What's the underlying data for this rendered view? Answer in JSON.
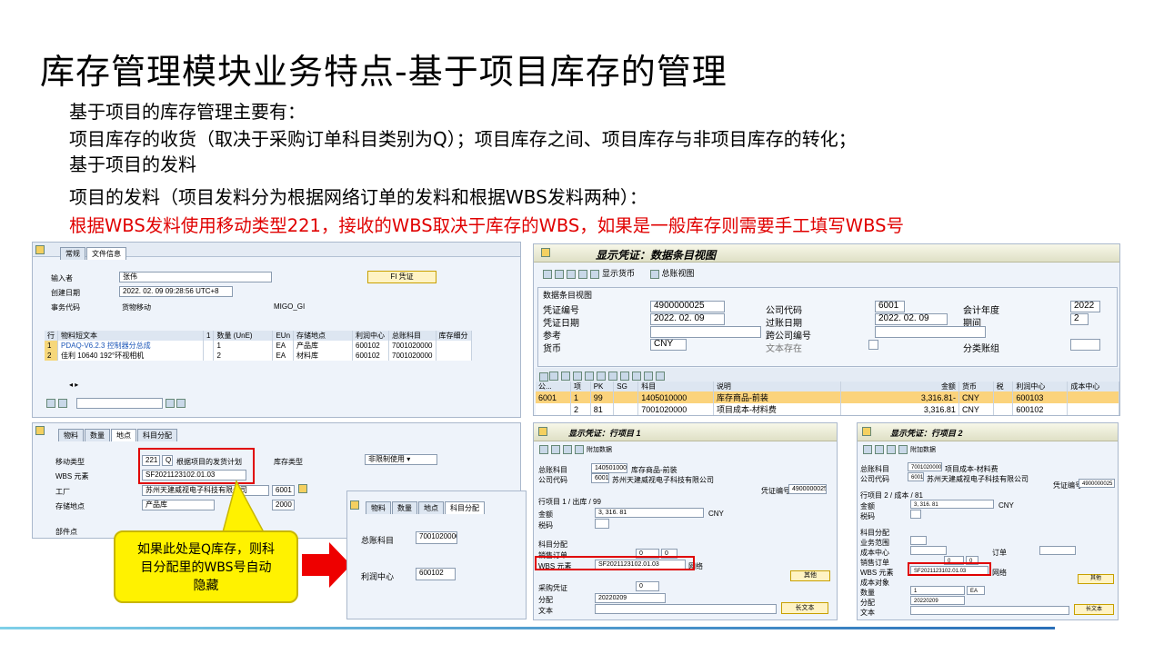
{
  "title": "库存管理模块业务特点-基于项目库存的管理",
  "bullets": [
    "基于项目的库存管理主要有：",
    "项目库存的收货（取决于采购订单科目类别为Q）；项目库存之间、项目库存与非项目库存的转化；",
    "基于项目的发料",
    "项目的发料（项目发料分为根据网络订单的发料和根据WBS发料两种）：",
    "根据WBS发料使用移动类型221，接收的WBS取决于库存的WBS，如果是一般库存则需要手工填写WBS号"
  ],
  "callout": {
    "lines": [
      "如果此处是Q库存，则科",
      "目分配里的WBS号自动",
      "隐藏"
    ]
  },
  "migo": {
    "tabs": [
      "常规",
      "文件信息"
    ],
    "rows": [
      {
        "label": "输入者",
        "value": "张伟"
      },
      {
        "label": "创建日期",
        "value": "2022. 02. 09 09:28:56 UTC+8"
      },
      {
        "label": "事务代码",
        "value": "货物移动",
        "extra": "MIGO_GI"
      }
    ],
    "fi_button": "FI 凭证",
    "table_headers": [
      "行",
      "物料短文本",
      "1",
      "数量 (UnE)",
      "EUn",
      "存储地点",
      "利润中心",
      "总账科目",
      "库存细分"
    ],
    "table_rows": [
      {
        "line": "1",
        "text": "PDAQ-V6.2.3 控制器分总成",
        "qty": "1",
        "eun": "EA",
        "sloc": "产品库",
        "pc": "600102",
        "gl": "7001020000"
      },
      {
        "line": "2",
        "text": "佳利 10640 192°环视相机",
        "qty": "2",
        "eun": "EA",
        "sloc": "材料库",
        "pc": "600102",
        "gl": "7001020000"
      }
    ],
    "detail_tabs": [
      "物料",
      "数量",
      "地点",
      "科目分配"
    ],
    "detail": {
      "move_type_label": "移动类型",
      "move_type": "221",
      "q": "Q",
      "move_desc": "根据项目的发货计划",
      "stock_type_label": "库存类型",
      "stock_type": "非限制使用",
      "wbs_label": "WBS 元素",
      "wbs": "SF2021123102.01.03",
      "plant_label": "工厂",
      "plant": "苏州天建威视电子科技有限公司",
      "plant_code": "6001",
      "sloc_label": "存储地点",
      "sloc": "产品库",
      "sloc_code": "2000",
      "bin_label": "部件点"
    }
  },
  "popup": {
    "tabs": [
      "物料",
      "数量",
      "地点",
      "科目分配"
    ],
    "gl_label": "总账科目",
    "gl": "7001020000",
    "pc_label": "利润中心",
    "pc": "600102"
  },
  "doc": {
    "title": "显示凭证：数据条目视图",
    "toolbar": [
      "显示货币",
      "总账视图"
    ],
    "section": "数据条目视图",
    "fields": {
      "docno_label": "凭证编号",
      "docno": "4900000025",
      "company_label": "公司代码",
      "company": "6001",
      "year_label": "会计年度",
      "year": "2022",
      "docdate_label": "凭证日期",
      "docdate": "2022. 02. 09",
      "postdate_label": "过账日期",
      "postdate": "2022. 02. 09",
      "period_label": "期间",
      "period": "2",
      "ref_label": "参考",
      "cross_label": "跨公司编号",
      "cur_label": "货币",
      "cur": "CNY",
      "text_label": "文本存在",
      "ledger_label": "分类账组"
    },
    "headers": [
      "公...",
      "项",
      "PK",
      "SG",
      "科目",
      "说明",
      "金额",
      "货币",
      "税",
      "利润中心",
      "成本中心"
    ],
    "rows": [
      {
        "co": "6001",
        "item": "1",
        "pk": "99",
        "acct": "1405010000",
        "desc": "库存商品-前装",
        "amt": "3,316.81-",
        "cur": "CNY",
        "pc": "600103"
      },
      {
        "co": "",
        "item": "2",
        "pk": "81",
        "acct": "7001020000",
        "desc": "项目成本-材料费",
        "amt": "3,316.81",
        "cur": "CNY",
        "pc": "600102"
      }
    ]
  },
  "item1": {
    "title": "显示凭证：行项目 1",
    "addl": "附加数据",
    "gl_label": "总账科目",
    "gl": "1405010000",
    "gl_desc": "库存商品-前装",
    "co_label": "公司代码",
    "co": "6001",
    "co_desc": "苏州天建威视电子科技有限公司",
    "docno_label": "凭证编号",
    "docno": "4900000025",
    "line_label": "行项目 1 / 出库 / 99",
    "amt_label": "金额",
    "amt": "3, 316. 81",
    "cur": "CNY",
    "tax_label": "税码",
    "assign_label": "科目分配",
    "so_label": "销售订单",
    "so1": "0",
    "so2": "0",
    "wbs_label": "WBS 元素",
    "wbs": "SF2021123102.01.03",
    "net": "网络",
    "more": "其他",
    "ref_label": "采购凭证",
    "ref": "0",
    "alloc_label": "分配",
    "alloc": "20220209",
    "text_label": "文本",
    "longtext": "长文本"
  },
  "item2": {
    "title": "显示凭证：行项目 2",
    "addl": "附加数据",
    "gl_label": "总账科目",
    "gl": "7001020000",
    "gl_desc": "项目成本-材料费",
    "co_label": "公司代码",
    "co": "6001",
    "co_desc": "苏州天建威视电子科技有限公司",
    "docno_label": "凭证编号",
    "docno": "4900000025",
    "line_label": "行项目 2 / 成本 / 81",
    "amt_label": "金额",
    "amt": "3, 316. 81",
    "cur": "CNY",
    "tax_label": "税码",
    "assign_label": "科目分配",
    "ba_label": "业务范围",
    "cc_label": "成本中心",
    "order_label": "订单",
    "so_label": "销售订单",
    "so1": "0",
    "so2": "0",
    "wbs_label": "WBS 元素",
    "wbs": "SF2021123102.01.03",
    "net": "网络",
    "more": "其他",
    "cost_label": "成本对象",
    "qty_label": "数量",
    "qty": "1",
    "unit": "EA",
    "alloc_label": "分配",
    "alloc": "20220209",
    "text_label": "文本",
    "longtext": "长文本"
  }
}
